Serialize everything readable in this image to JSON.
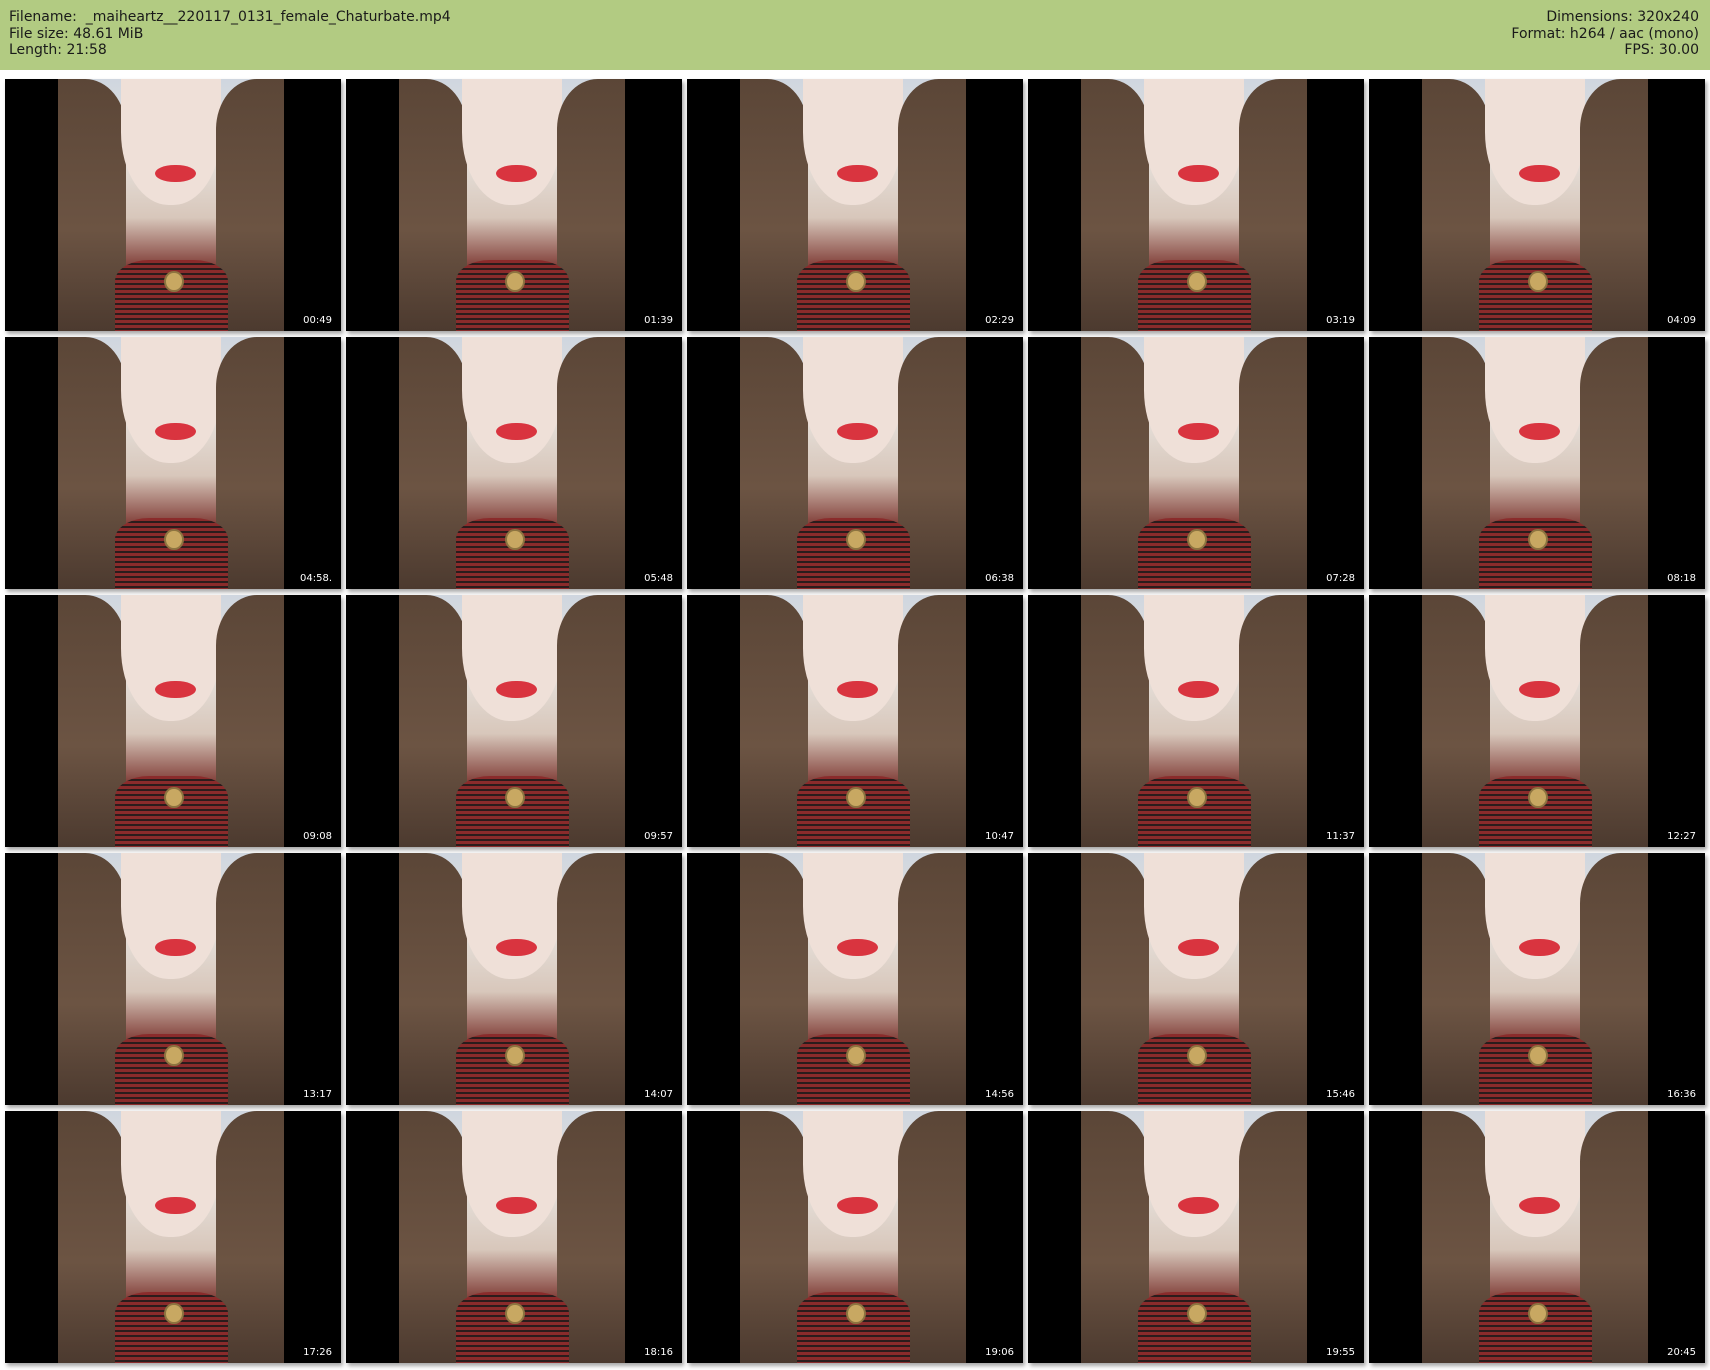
{
  "header": {
    "left": [
      "Filename:  _maiheartz__220117_0131_female_Chaturbate.mp4",
      "File size: 48.61 MiB",
      "Length: 21:58"
    ],
    "right": [
      "Dimensions: 320x240",
      "Format: h264 / aac (mono)",
      "FPS: 30.00"
    ]
  },
  "colors": {
    "header_bg": "#b2cb82",
    "lipstick": "#d9343f",
    "timestamp": "#ffffff"
  },
  "thumbnails": [
    {
      "time": "00:49"
    },
    {
      "time": "01:39"
    },
    {
      "time": "02:29"
    },
    {
      "time": "03:19"
    },
    {
      "time": "04:09"
    },
    {
      "time": "04:58."
    },
    {
      "time": "05:48"
    },
    {
      "time": "06:38"
    },
    {
      "time": "07:28"
    },
    {
      "time": "08:18"
    },
    {
      "time": "09:08"
    },
    {
      "time": "09:57"
    },
    {
      "time": "10:47"
    },
    {
      "time": "11:37"
    },
    {
      "time": "12:27"
    },
    {
      "time": "13:17"
    },
    {
      "time": "14:07"
    },
    {
      "time": "14:56"
    },
    {
      "time": "15:46"
    },
    {
      "time": "16:36"
    },
    {
      "time": "17:26"
    },
    {
      "time": "18:16"
    },
    {
      "time": "19:06"
    },
    {
      "time": "19:55"
    },
    {
      "time": "20:45"
    }
  ]
}
